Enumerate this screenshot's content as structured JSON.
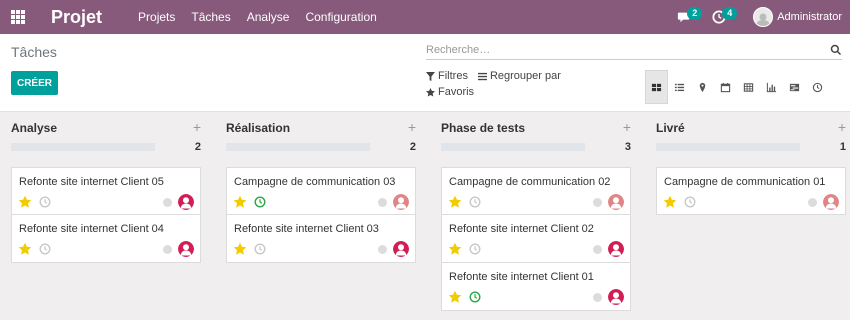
{
  "app": {
    "title": "Projet"
  },
  "menu": [
    "Projets",
    "Tâches",
    "Analyse",
    "Configuration"
  ],
  "systray": {
    "messages_count": "2",
    "activities_count": "4",
    "user_name": "Administrator"
  },
  "control": {
    "breadcrumb": "Tâches",
    "create_label": "CRÉER",
    "search_placeholder": "Recherche…",
    "filters_label": "Filtres",
    "group_by_label": "Regrouper par",
    "favorites_label": "Favoris",
    "views": [
      "kanban",
      "list",
      "map",
      "calendar",
      "pivot",
      "graph",
      "gantt",
      "activity"
    ],
    "active_view": "kanban"
  },
  "colors": {
    "navbar": "#875a7b",
    "accent": "#00a09d",
    "star": "#f3cc00",
    "avatar_dark": "#d21e55",
    "avatar_light": "#e08484",
    "clock_done": "#28a745"
  },
  "columns": [
    {
      "title": "Analyse",
      "count": "2",
      "cards": [
        {
          "title": "Refonte site internet Client 05",
          "starred": true,
          "clock": "grey",
          "avatar": "dark"
        },
        {
          "title": "Refonte site internet Client 04",
          "starred": true,
          "clock": "grey",
          "avatar": "dark"
        }
      ]
    },
    {
      "title": "Réalisation",
      "count": "2",
      "cards": [
        {
          "title": "Campagne de communication 03",
          "starred": true,
          "clock": "green",
          "avatar": "light"
        },
        {
          "title": "Refonte site internet Client 03",
          "starred": true,
          "clock": "grey",
          "avatar": "dark"
        }
      ]
    },
    {
      "title": "Phase de tests",
      "count": "3",
      "cards": [
        {
          "title": "Campagne de communication 02",
          "starred": true,
          "clock": "grey",
          "avatar": "light"
        },
        {
          "title": "Refonte site internet Client 02",
          "starred": true,
          "clock": "grey",
          "avatar": "dark"
        },
        {
          "title": "Refonte site internet Client 01",
          "starred": true,
          "clock": "green",
          "avatar": "dark"
        }
      ]
    },
    {
      "title": "Livré",
      "count": "1",
      "cards": [
        {
          "title": "Campagne de communication 01",
          "starred": true,
          "clock": "grey",
          "avatar": "light"
        }
      ]
    }
  ]
}
